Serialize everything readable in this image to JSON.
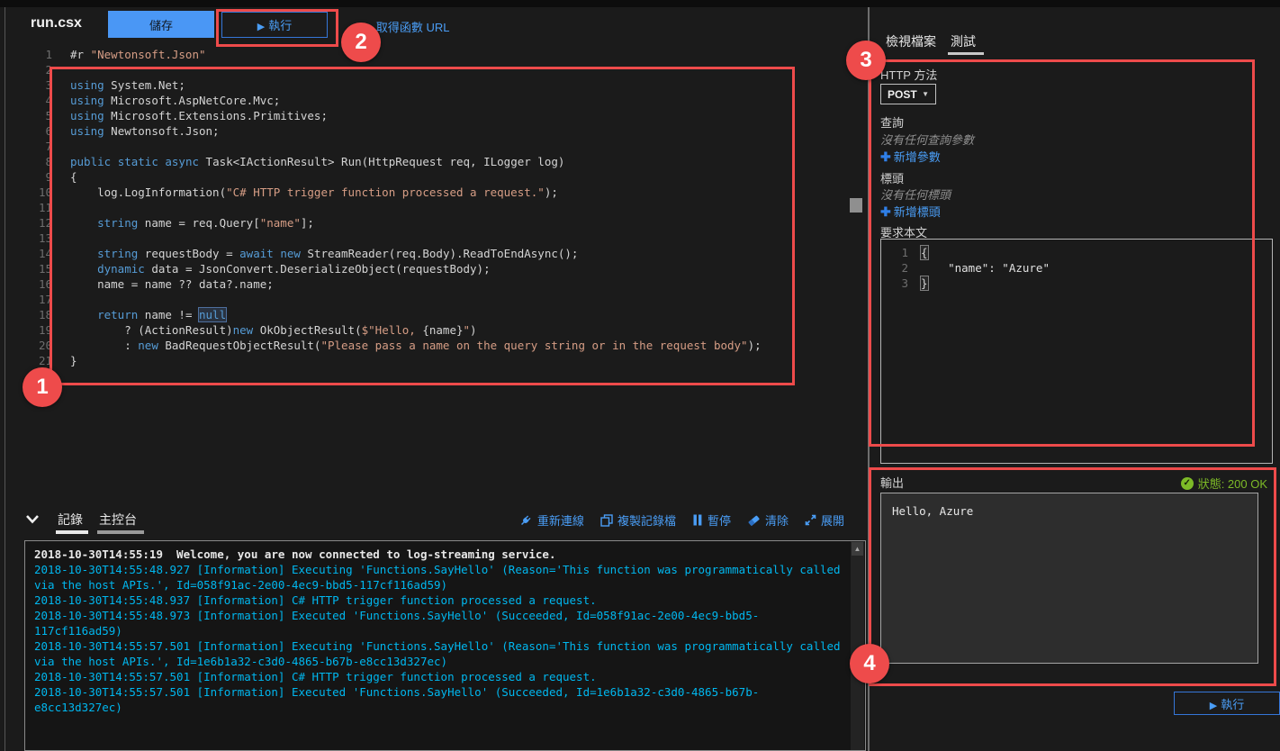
{
  "topbar": {
    "filename": "run.csx",
    "save_label": "儲存",
    "run_label": "執行",
    "get_url_label": "取得函數 URL"
  },
  "editor": {
    "lines": [
      {
        "n": 1,
        "tokens": [
          {
            "t": "#r ",
            "c": "p"
          },
          {
            "t": "\"Newtonsoft.Json\"",
            "c": "s"
          }
        ]
      },
      {
        "n": 2,
        "tokens": []
      },
      {
        "n": 3,
        "tokens": [
          {
            "t": "using",
            "c": "k"
          },
          {
            "t": " System.Net;",
            "c": "p"
          }
        ]
      },
      {
        "n": 4,
        "tokens": [
          {
            "t": "using",
            "c": "k"
          },
          {
            "t": " Microsoft.AspNetCore.Mvc;",
            "c": "p"
          }
        ]
      },
      {
        "n": 5,
        "tokens": [
          {
            "t": "using",
            "c": "k"
          },
          {
            "t": " Microsoft.Extensions.Primitives;",
            "c": "p"
          }
        ]
      },
      {
        "n": 6,
        "tokens": [
          {
            "t": "using",
            "c": "k"
          },
          {
            "t": " Newtonsoft.Json;",
            "c": "p"
          }
        ]
      },
      {
        "n": 7,
        "tokens": []
      },
      {
        "n": 8,
        "tokens": [
          {
            "t": "public",
            "c": "k"
          },
          {
            "t": " ",
            "c": "p"
          },
          {
            "t": "static",
            "c": "k"
          },
          {
            "t": " ",
            "c": "p"
          },
          {
            "t": "async",
            "c": "k"
          },
          {
            "t": " Task<IActionResult> Run(HttpRequest req, ILogger log)",
            "c": "p"
          }
        ]
      },
      {
        "n": 9,
        "tokens": [
          {
            "t": "{",
            "c": "p"
          }
        ]
      },
      {
        "n": 10,
        "tokens": [
          {
            "t": "    log.LogInformation(",
            "c": "p"
          },
          {
            "t": "\"C# HTTP trigger function processed a request.\"",
            "c": "s"
          },
          {
            "t": ");",
            "c": "p"
          }
        ]
      },
      {
        "n": 11,
        "tokens": []
      },
      {
        "n": 12,
        "tokens": [
          {
            "t": "    ",
            "c": "p"
          },
          {
            "t": "string",
            "c": "k"
          },
          {
            "t": " name = req.Query[",
            "c": "p"
          },
          {
            "t": "\"name\"",
            "c": "s"
          },
          {
            "t": "];",
            "c": "p"
          }
        ]
      },
      {
        "n": 13,
        "tokens": []
      },
      {
        "n": 14,
        "tokens": [
          {
            "t": "    ",
            "c": "p"
          },
          {
            "t": "string",
            "c": "k"
          },
          {
            "t": " requestBody = ",
            "c": "p"
          },
          {
            "t": "await",
            "c": "k"
          },
          {
            "t": " ",
            "c": "p"
          },
          {
            "t": "new",
            "c": "k"
          },
          {
            "t": " StreamReader(req.Body).ReadToEndAsync();",
            "c": "p"
          }
        ]
      },
      {
        "n": 15,
        "tokens": [
          {
            "t": "    ",
            "c": "p"
          },
          {
            "t": "dynamic",
            "c": "k"
          },
          {
            "t": " data = JsonConvert.DeserializeObject(requestBody);",
            "c": "p"
          }
        ]
      },
      {
        "n": 16,
        "tokens": [
          {
            "t": "    name = name ?? data?.name;",
            "c": "p"
          }
        ]
      },
      {
        "n": 17,
        "tokens": []
      },
      {
        "n": 18,
        "tokens": [
          {
            "t": "    ",
            "c": "p"
          },
          {
            "t": "return",
            "c": "k"
          },
          {
            "t": " name != ",
            "c": "p"
          },
          {
            "t": "null",
            "c": "kh"
          }
        ]
      },
      {
        "n": 19,
        "tokens": [
          {
            "t": "        ? (ActionResult)",
            "c": "p"
          },
          {
            "t": "new",
            "c": "k"
          },
          {
            "t": " OkObjectResult(",
            "c": "p"
          },
          {
            "t": "$\"Hello, ",
            "c": "s"
          },
          {
            "t": "{name}",
            "c": "p"
          },
          {
            "t": "\"",
            "c": "s"
          },
          {
            "t": ")",
            "c": "p"
          }
        ]
      },
      {
        "n": 20,
        "tokens": [
          {
            "t": "        : ",
            "c": "p"
          },
          {
            "t": "new",
            "c": "k"
          },
          {
            "t": " BadRequestObjectResult(",
            "c": "p"
          },
          {
            "t": "\"Please pass a name on the query string or in the request body\"",
            "c": "s"
          },
          {
            "t": ");",
            "c": "p"
          }
        ]
      },
      {
        "n": 21,
        "tokens": [
          {
            "t": "}",
            "c": "p"
          }
        ]
      }
    ]
  },
  "log_panel": {
    "tabs": {
      "logs": "記錄",
      "console": "主控台"
    },
    "toolbar": {
      "reconnect": "重新連線",
      "copy": "複製記錄檔",
      "pause": "暫停",
      "clear": "清除",
      "expand": "展開"
    },
    "lines": [
      {
        "text": "2018-10-30T14:55:19  Welcome, you are now connected to log-streaming service.",
        "color": "white"
      },
      {
        "text": "2018-10-30T14:55:48.927 [Information] Executing 'Functions.SayHello' (Reason='This function was programmatically called via the host APIs.', Id=058f91ac-2e00-4ec9-bbd5-117cf116ad59)",
        "color": "cyan"
      },
      {
        "text": "2018-10-30T14:55:48.937 [Information] C# HTTP trigger function processed a request.",
        "color": "cyan"
      },
      {
        "text": "2018-10-30T14:55:48.973 [Information] Executed 'Functions.SayHello' (Succeeded, Id=058f91ac-2e00-4ec9-bbd5-117cf116ad59)",
        "color": "cyan"
      },
      {
        "text": "2018-10-30T14:55:57.501 [Information] Executing 'Functions.SayHello' (Reason='This function was programmatically called via the host APIs.', Id=1e6b1a32-c3d0-4865-b67b-e8cc13d327ec)",
        "color": "cyan"
      },
      {
        "text": "2018-10-30T14:55:57.501 [Information] C# HTTP trigger function processed a request.",
        "color": "cyan"
      },
      {
        "text": "2018-10-30T14:55:57.501 [Information] Executed 'Functions.SayHello' (Succeeded, Id=1e6b1a32-c3d0-4865-b67b-e8cc13d327ec)",
        "color": "cyan"
      }
    ]
  },
  "right_panel": {
    "tabs": {
      "view_files": "檢視檔案",
      "test": "測試"
    },
    "http_method_label": "HTTP 方法",
    "http_method_value": "POST",
    "query_label": "查詢",
    "query_empty": "沒有任何查詢參數",
    "add_param": "新增參數",
    "headers_label": "標頭",
    "headers_empty": "沒有任何標頭",
    "add_header": "新增標頭",
    "body_label": "要求本文",
    "body_lines": [
      {
        "n": 1,
        "tokens": [
          {
            "t": "{",
            "c": "bm"
          }
        ]
      },
      {
        "n": 2,
        "tokens": [
          {
            "t": "    \"name\": \"Azure\"",
            "c": "p"
          }
        ]
      },
      {
        "n": 3,
        "tokens": [
          {
            "t": "}",
            "c": "bm"
          }
        ]
      }
    ],
    "output_label": "輸出",
    "status_text": "狀態: 200 OK",
    "output_text": "Hello, Azure",
    "run_label": "執行"
  },
  "annotations": [
    "1",
    "2",
    "3",
    "4"
  ],
  "colors": {
    "accent_blue": "#4a9df5",
    "save_blue": "#4a97f5",
    "keyword": "#569cd6",
    "string": "#d69d85",
    "log_cyan": "#00b7ef",
    "status_green": "#7dba27",
    "annotation_red": "#ee4b4b"
  }
}
